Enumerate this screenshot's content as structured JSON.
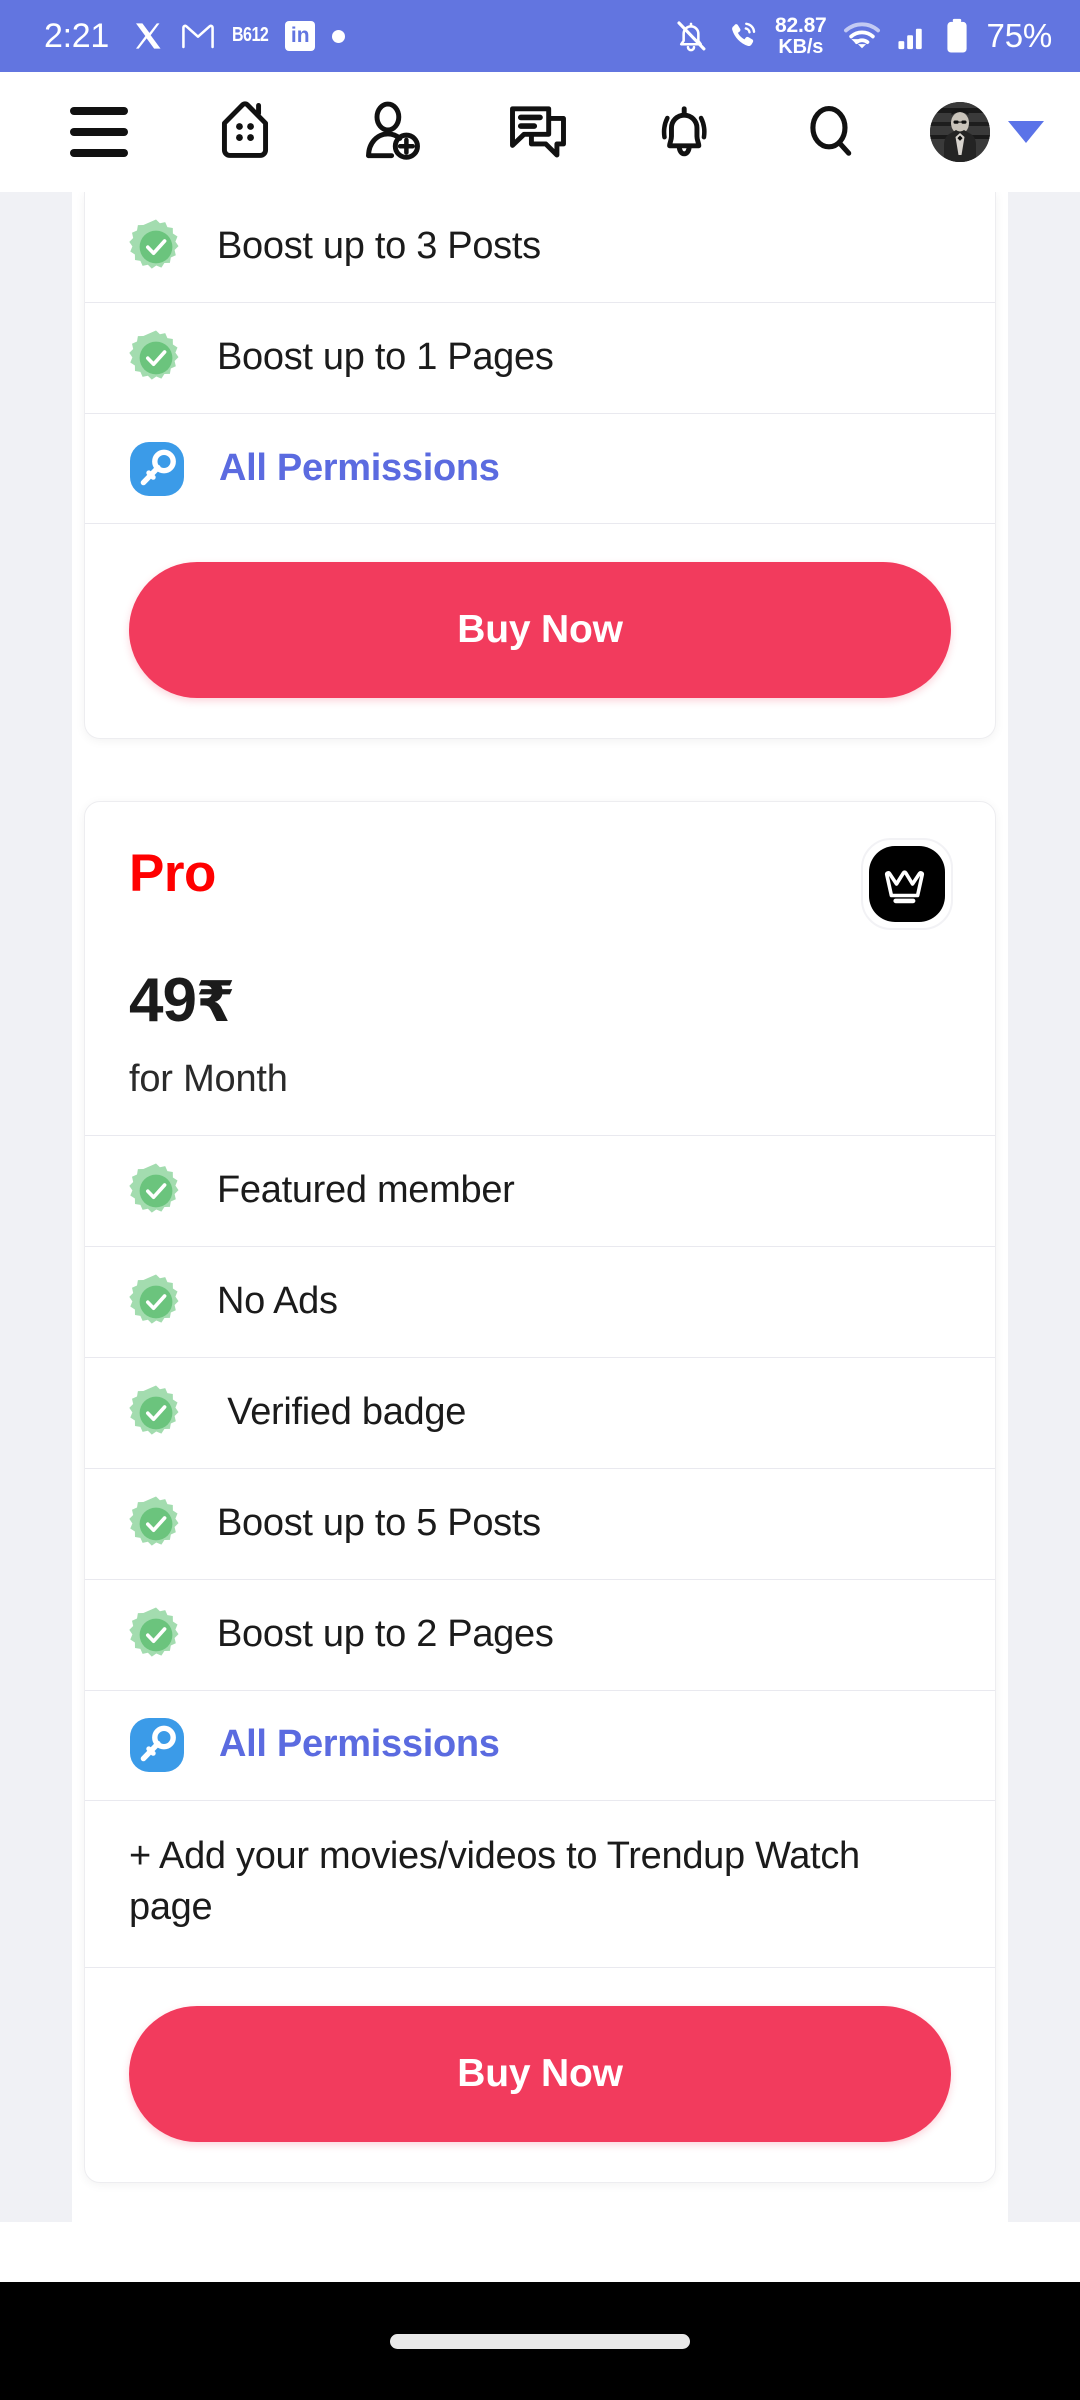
{
  "status_bar": {
    "time": "2:21",
    "left_icons": [
      "x-app-icon",
      "gmail-icon",
      "b612-icon",
      "linkedin-icon",
      "notification-dot-icon"
    ],
    "b612_label": "B612",
    "linkedin_label": "in",
    "net_speed_value": "82.87",
    "net_speed_unit": "KB/s",
    "battery_percent": "75%",
    "right_icons": [
      "bell-off-icon",
      "call-icon",
      "wifi-icon",
      "signal-icon",
      "battery-icon"
    ],
    "background_color": "#6275E0"
  },
  "app_header": {
    "icons": [
      "hamburger-menu-icon",
      "home-icon",
      "add-friend-icon",
      "messages-icon",
      "notifications-bell-icon",
      "search-icon"
    ],
    "avatar": "user-avatar",
    "chevron": "chevron-down-icon",
    "chevron_color": "#5B73E8"
  },
  "plans": [
    {
      "clipped": true,
      "features": [
        {
          "icon": "verified-check-icon",
          "label": "Boost up to 3 Posts",
          "type": "check"
        },
        {
          "icon": "verified-check-icon",
          "label": "Boost up to 1 Pages",
          "type": "check"
        },
        {
          "icon": "key-icon",
          "label": "All Permissions",
          "type": "link"
        }
      ],
      "cta_label": "Buy Now"
    },
    {
      "clipped": false,
      "name": "Pro",
      "name_color": "#FF0000",
      "badge_icon": "crown-icon",
      "price_amount": "49",
      "price_currency": "₹",
      "price_period": "for Month",
      "features": [
        {
          "icon": "verified-check-icon",
          "label": "Featured member",
          "type": "check"
        },
        {
          "icon": "verified-check-icon",
          "label": "No Ads",
          "type": "check"
        },
        {
          "icon": "verified-check-icon",
          "label": " Verified badge",
          "type": "check"
        },
        {
          "icon": "verified-check-icon",
          "label": "Boost up to 5 Posts",
          "type": "check"
        },
        {
          "icon": "verified-check-icon",
          "label": "Boost up to 2 Pages",
          "type": "check"
        },
        {
          "icon": "key-icon",
          "label": "All Permissions",
          "type": "link"
        }
      ],
      "note": "+ Add your movies/videos to Trendup Watch page",
      "cta_label": "Buy Now"
    }
  ],
  "colors": {
    "accent_buy": "#F23B5D",
    "link_blue": "#5B6BE0",
    "check_green": "#6BC47D",
    "check_green_light": "#A3DCAF",
    "key_blue": "#3B9BE8",
    "page_bg": "#F0F1F5"
  },
  "nav_bar": {
    "home_indicator": "home-indicator-pill",
    "background_color": "#000000"
  }
}
